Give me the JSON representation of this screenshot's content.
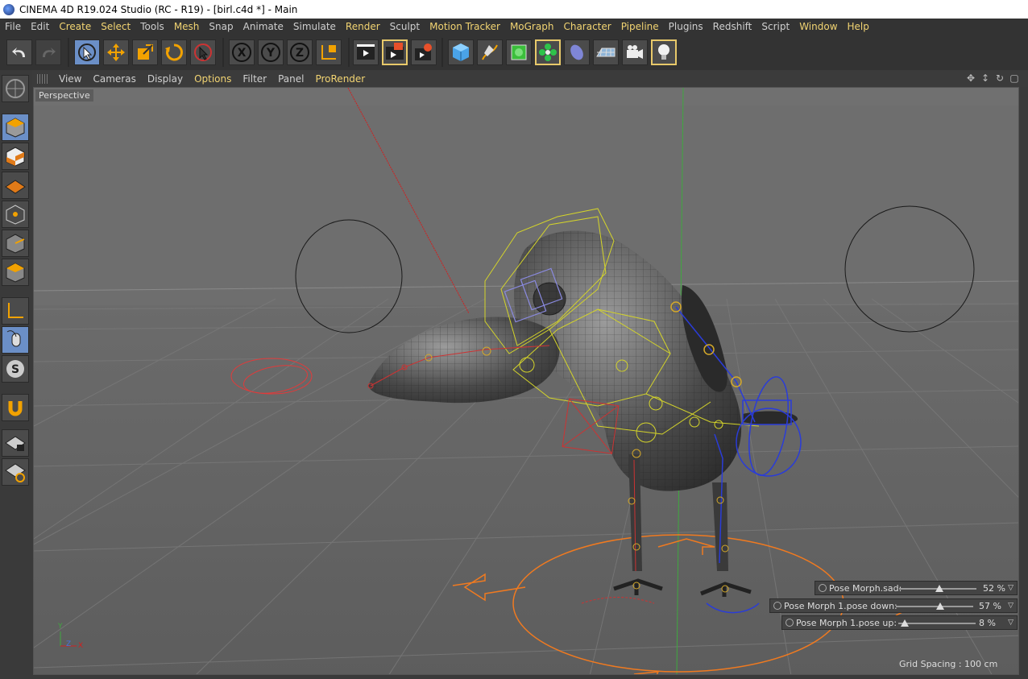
{
  "window": {
    "title": "CINEMA 4D R19.024 Studio (RC - R19) - [birl.c4d *] - Main"
  },
  "menu": [
    {
      "label": "File",
      "hl": false
    },
    {
      "label": "Edit",
      "hl": false
    },
    {
      "label": "Create",
      "hl": true
    },
    {
      "label": "Select",
      "hl": true
    },
    {
      "label": "Tools",
      "hl": false
    },
    {
      "label": "Mesh",
      "hl": true
    },
    {
      "label": "Snap",
      "hl": false
    },
    {
      "label": "Animate",
      "hl": false
    },
    {
      "label": "Simulate",
      "hl": false
    },
    {
      "label": "Render",
      "hl": true
    },
    {
      "label": "Sculpt",
      "hl": false
    },
    {
      "label": "Motion Tracker",
      "hl": true
    },
    {
      "label": "MoGraph",
      "hl": true
    },
    {
      "label": "Character",
      "hl": true
    },
    {
      "label": "Pipeline",
      "hl": true
    },
    {
      "label": "Plugins",
      "hl": false
    },
    {
      "label": "Redshift",
      "hl": false
    },
    {
      "label": "Script",
      "hl": false
    },
    {
      "label": "Window",
      "hl": true
    },
    {
      "label": "Help",
      "hl": true
    }
  ],
  "toolbar": {
    "icons": [
      "undo-icon",
      "redo-icon",
      "live-selection-icon",
      "move-icon",
      "scale-icon",
      "rotate-icon",
      "select-cursor-icon",
      "x-axis-icon",
      "y-axis-icon",
      "z-axis-icon",
      "coordinate-system-icon",
      "render-view-icon",
      "render-picture-viewer-icon",
      "render-settings-icon",
      "cube-icon",
      "pen-icon",
      "subdivision-icon",
      "cloner-icon",
      "deformer-icon",
      "floor-icon",
      "camera-icon",
      "light-icon"
    ]
  },
  "viewport_menu": [
    {
      "label": "View",
      "hl": false
    },
    {
      "label": "Cameras",
      "hl": false
    },
    {
      "label": "Display",
      "hl": false
    },
    {
      "label": "Options",
      "hl": true
    },
    {
      "label": "Filter",
      "hl": false
    },
    {
      "label": "Panel",
      "hl": false
    },
    {
      "label": "ProRender",
      "hl": true
    }
  ],
  "viewport": {
    "camera_label": "Perspective",
    "grid_spacing": "Grid Spacing : 100 cm",
    "axis": {
      "y": "Y",
      "z": "Z",
      "x": "X"
    }
  },
  "pose_morphs": [
    {
      "name": "Pose Morph.sad:",
      "value_text": "52 %",
      "value": 0.52
    },
    {
      "name": "Pose Morph 1.pose down:",
      "value_text": "57 %",
      "value": 0.57
    },
    {
      "name": "Pose Morph 1.pose up:",
      "value_text": "8 %",
      "value": 0.08
    }
  ],
  "colors": {
    "accent": "#f2d472",
    "active_button": "#6b8fc7",
    "selection_outline": "#e8c96a"
  }
}
